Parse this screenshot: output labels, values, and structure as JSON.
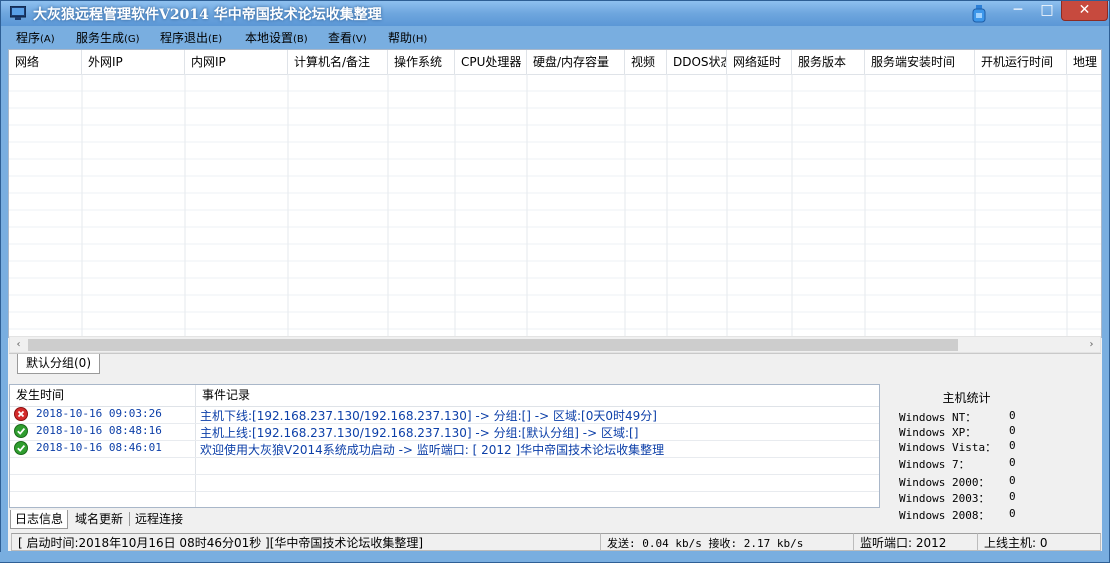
{
  "window": {
    "title": "大灰狼远程管理软件V2014  华中帝国技术论坛收集整理",
    "close_symbol": "✕",
    "minimize_symbol": "─",
    "maximize_symbol": "□"
  },
  "menu": [
    {
      "label": "程序",
      "key": "(A)"
    },
    {
      "label": "服务生成",
      "key": "(G)"
    },
    {
      "label": "程序退出",
      "key": "(E)"
    },
    {
      "label": "本地设置",
      "key": "(B)"
    },
    {
      "label": "查看",
      "key": "(V)"
    },
    {
      "label": "帮助",
      "key": "(H)"
    }
  ],
  "grid": {
    "columns": [
      "网络",
      "外网IP",
      "内网IP",
      "计算机名/备注",
      "操作系统",
      "CPU处理器",
      "硬盘/内存容量",
      "视频",
      "DDOS状态",
      "网络延时",
      "服务版本",
      "服务端安装时间",
      "开机运行时间",
      "地理"
    ]
  },
  "scroll": {
    "left": "‹",
    "right": "›"
  },
  "group_tab": "默认分组(0)",
  "log": {
    "headers": [
      "发生时间",
      "事件记录"
    ],
    "rows": [
      {
        "status": "error",
        "time": "2018-10-16 09:03:26",
        "message": "主机下线:[192.168.237.130/192.168.237.130] -> 分组:[] -> 区域:[0天0时49分]"
      },
      {
        "status": "ok",
        "time": "2018-10-16 08:48:16",
        "message": "主机上线:[192.168.237.130/192.168.237.130] -> 分组:[默认分组] -> 区域:[]"
      },
      {
        "status": "ok",
        "time": "2018-10-16 08:46:01",
        "message": "欢迎使用大灰狼V2014系统成功启动 -> 监听端口: [ 2012 ]华中帝国技术论坛收集整理"
      }
    ]
  },
  "bottom_tabs": [
    "日志信息",
    "域名更新",
    "远程连接"
  ],
  "stats": {
    "title": "主机统计",
    "rows": [
      {
        "label": "Windows NT：",
        "value": "0"
      },
      {
        "label": "Windows XP：",
        "value": "0"
      },
      {
        "label": "Windows Vista：",
        "value": "0"
      },
      {
        "label": "Windows 7：",
        "value": "0"
      },
      {
        "label": "Windows 2000：",
        "value": "0"
      },
      {
        "label": "Windows 2003：",
        "value": "0"
      },
      {
        "label": "Windows 2008：",
        "value": "0"
      }
    ]
  },
  "status": {
    "start": "[ 启动时间:2018年10月16日 08时46分01秒 ][华中帝国技术论坛收集整理]",
    "speed": "发送: 0.04 kb/s 接收: 2.17 kb/s",
    "port": "监听端口: 2012",
    "online": "上线主机: 0"
  },
  "colors": {
    "title_bar": "#6ea6de",
    "log_text": "#0c3fa8",
    "error_icon": "#d42a2a",
    "ok_icon": "#2f9e2f"
  }
}
